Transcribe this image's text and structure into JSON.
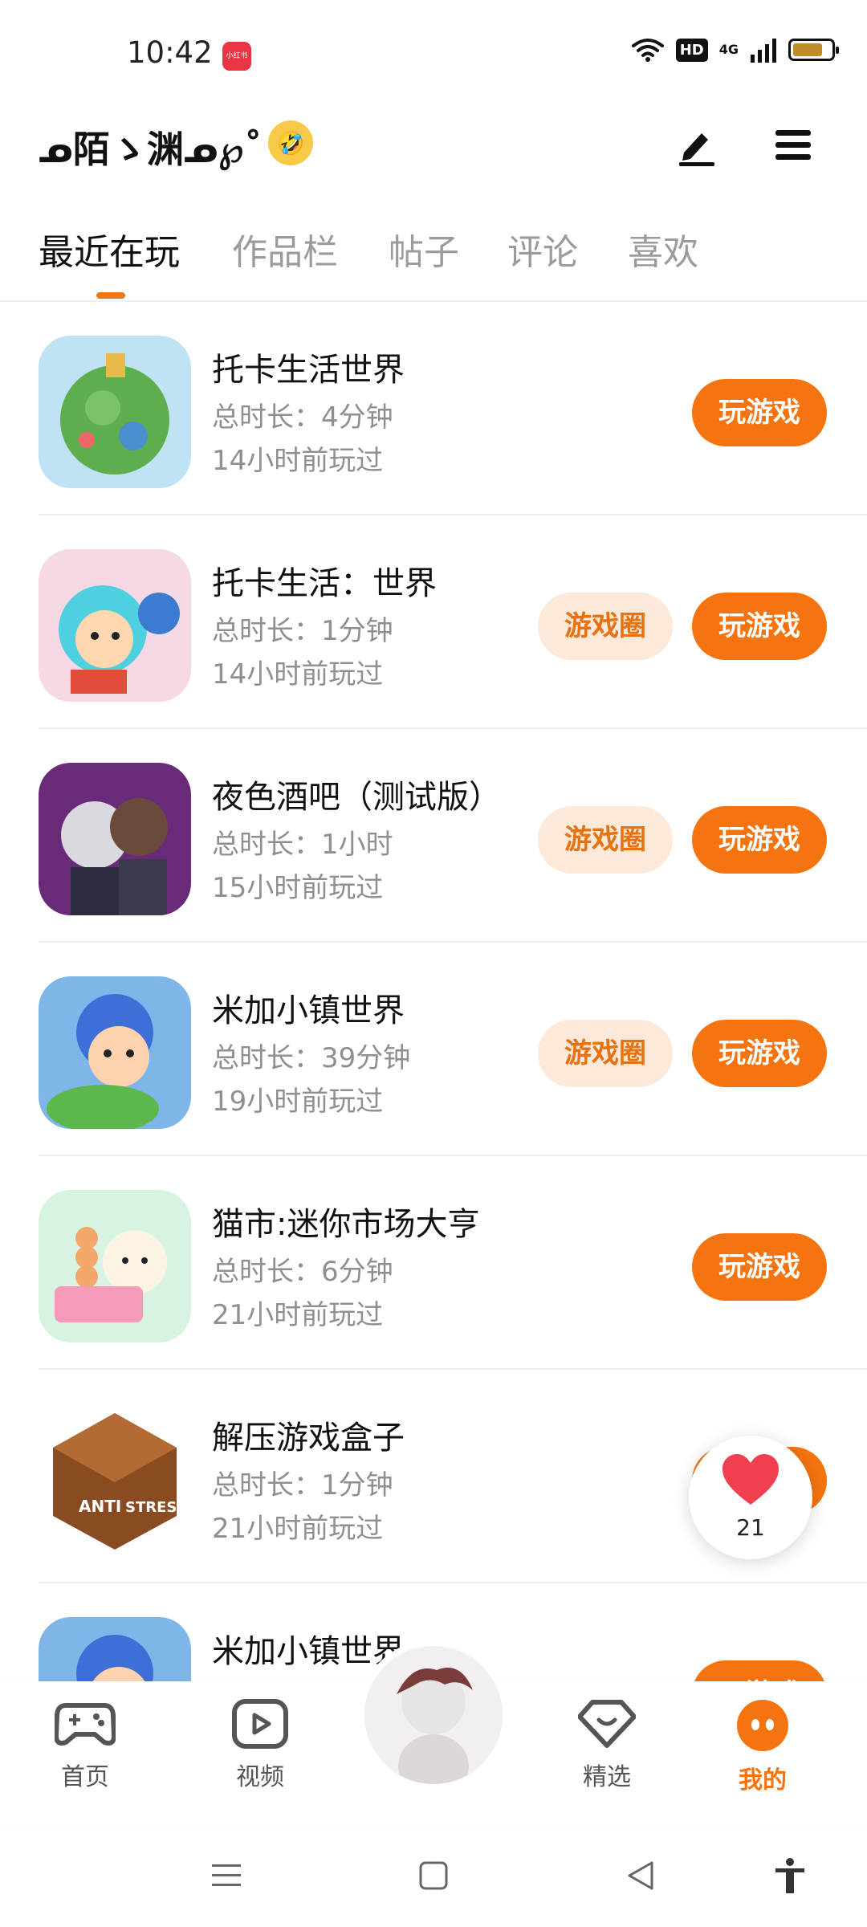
{
  "status_bar": {
    "time": "10:42",
    "app_badge": "小红书",
    "hd_label": "HD",
    "network_label": "4G",
    "battery_level": 0.7,
    "wifi_icon": "wifi-icon",
    "battery_icon": "battery-icon"
  },
  "header": {
    "nickname": "ᓄ陌ゝ渊ᓄ℘˚",
    "emoji": "🤣",
    "edit_icon": "pen-icon",
    "menu_icon": "menu-icon"
  },
  "tabs": [
    {
      "label": "最近在玩",
      "active": true
    },
    {
      "label": "作品栏",
      "active": false
    },
    {
      "label": "帖子",
      "active": false
    },
    {
      "label": "评论",
      "active": false
    },
    {
      "label": "喜欢",
      "active": false
    }
  ],
  "games": [
    {
      "name": "托卡生活世界",
      "duration": "总时长：4分钟",
      "last_played": "14小时前玩过",
      "has_circle": false,
      "play_label": "玩游戏"
    },
    {
      "name": "托卡生活：世界",
      "duration": "总时长：1分钟",
      "last_played": "14小时前玩过",
      "has_circle": true,
      "circle_label": "游戏圈",
      "play_label": "玩游戏"
    },
    {
      "name": "夜色酒吧（测试版）",
      "duration": "总时长：1小时",
      "last_played": "15小时前玩过",
      "has_circle": true,
      "circle_label": "游戏圈",
      "play_label": "玩游戏"
    },
    {
      "name": "米加小镇世界",
      "duration": "总时长：39分钟",
      "last_played": "19小时前玩过",
      "has_circle": true,
      "circle_label": "游戏圈",
      "play_label": "玩游戏"
    },
    {
      "name": "猫市:迷你市场大亨",
      "duration": "总时长：6分钟",
      "last_played": "21小时前玩过",
      "has_circle": false,
      "play_label": "玩游戏"
    },
    {
      "name": "解压游戏盒子",
      "duration": "总时长：1分钟",
      "last_played": "21小时前玩过",
      "has_circle": false,
      "play_label": "玩游戏",
      "icon_text_left": "ANTI",
      "icon_text_right": "STRESS"
    },
    {
      "name": "米加小镇世界",
      "duration": "",
      "last_played": "",
      "has_circle": false,
      "play_label": "玩游戏"
    }
  ],
  "floating_like": {
    "count": "21",
    "icon": "heart-icon"
  },
  "bottom_nav": [
    {
      "label": "首页",
      "icon": "gamepad-icon",
      "active": false
    },
    {
      "label": "视频",
      "icon": "video-play-icon",
      "active": false
    },
    {
      "label": "精选",
      "icon": "heart-diamond-icon",
      "active": false
    },
    {
      "label": "我的",
      "icon": "face-icon",
      "active": true
    }
  ],
  "system_nav": [
    "menu-icon",
    "home-square-icon",
    "back-triangle-icon",
    "accessibility-icon"
  ],
  "colors": {
    "accent": "#f6740f",
    "circle_bg": "#fde9da",
    "text_secondary": "#8f8f8f"
  }
}
